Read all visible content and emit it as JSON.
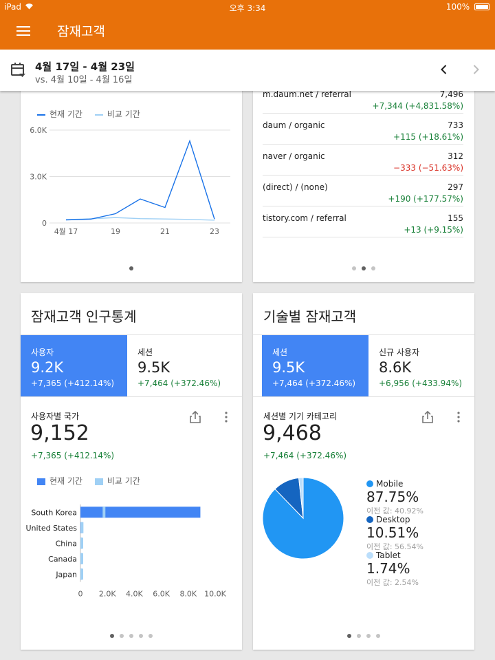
{
  "status": {
    "device": "iPad",
    "time": "오후 3:34",
    "battery": "100%"
  },
  "app": {
    "title": "잠재고객"
  },
  "date_range": {
    "main": "4월 17일 - 4월 23일",
    "comparison": "vs. 4월 10일 - 4월 16일"
  },
  "colors": {
    "brand": "#e8710a",
    "accent": "#4285f4",
    "positive": "#188038",
    "negative": "#d93025"
  },
  "icons": [
    "menu-icon",
    "calendar-icon",
    "chevron-left-icon",
    "chevron-right-icon",
    "share-icon",
    "more-vert-icon"
  ],
  "line_card": {
    "legend_current": "현재 기간",
    "legend_compare": "비교 기간",
    "page_dots": 1,
    "active_dot": 0
  },
  "referral_card": {
    "rows": [
      {
        "name": "m.daum.net / referral",
        "value": "7,496",
        "delta": "+7,344 (+4,831.58%)",
        "sign": "pos"
      },
      {
        "name": "daum / organic",
        "value": "733",
        "delta": "+115 (+18.61%)",
        "sign": "pos"
      },
      {
        "name": "naver / organic",
        "value": "312",
        "delta": "−333 (−51.63%)",
        "sign": "neg"
      },
      {
        "name": "(direct) / (none)",
        "value": "297",
        "delta": "+190 (+177.57%)",
        "sign": "pos"
      },
      {
        "name": "tistory.com / referral",
        "value": "155",
        "delta": "+13 (+9.15%)",
        "sign": "pos"
      }
    ],
    "page_dots": 3,
    "active_dot": 1
  },
  "demo_card": {
    "title": "잠재고객 인구통계",
    "tiles": [
      {
        "label": "사용자",
        "value": "9.2K",
        "delta": "+7,365 (+412.14%)"
      },
      {
        "label": "세션",
        "value": "9.5K",
        "delta": "+7,464 (+372.46%)"
      }
    ],
    "sub_label": "사용자별 국가",
    "big_number": "9,152",
    "big_delta": "+7,365 (+412.14%)",
    "legend_current": "현재 기간",
    "legend_compare": "비교 기간",
    "page_dots": 5,
    "active_dot": 0
  },
  "tech_card": {
    "title": "기술별 잠재고객",
    "tiles": [
      {
        "label": "세션",
        "value": "9.5K",
        "delta": "+7,464 (+372.46%)"
      },
      {
        "label": "신규 사용자",
        "value": "8.6K",
        "delta": "+6,956 (+433.94%)"
      }
    ],
    "sub_label": "세션별 기기 카테고리",
    "big_number": "9,468",
    "big_delta": "+7,464 (+372.46%)",
    "legend": [
      {
        "name": "Mobile",
        "pct": "87.75%",
        "prev": "이전 값: 40.92%",
        "color": "#2196f3"
      },
      {
        "name": "Desktop",
        "pct": "10.51%",
        "prev": "이전 값: 56.54%",
        "color": "#1565c0"
      },
      {
        "name": "Tablet",
        "pct": "1.74%",
        "prev": "이전 값: 2.54%",
        "color": "#bbdefb"
      }
    ],
    "page_dots": 4,
    "active_dot": 0
  },
  "chart_data": [
    {
      "type": "line",
      "x": [
        "4월 17",
        "18",
        "19",
        "20",
        "21",
        "22",
        "23"
      ],
      "x_tick_labels": [
        "4월 17",
        "19",
        "21",
        "23"
      ],
      "y_tick_labels": [
        "0",
        "3.0K",
        "6.0K"
      ],
      "ylim": [
        0,
        6000
      ],
      "series": [
        {
          "name": "현재 기간",
          "color": "#1a73e8",
          "values": [
            200,
            250,
            600,
            1550,
            1000,
            5300,
            250
          ]
        },
        {
          "name": "비교 기간",
          "color": "#9fd0f5",
          "values": [
            220,
            270,
            350,
            280,
            260,
            230,
            180
          ]
        }
      ],
      "grid": true,
      "legend": "top-left"
    },
    {
      "type": "bar",
      "orientation": "horizontal",
      "categories": [
        "South Korea",
        "United States",
        "China",
        "Canada",
        "Japan"
      ],
      "series": [
        {
          "name": "현재 기간",
          "color": "#4285f4",
          "values": [
            8900,
            150,
            100,
            90,
            80
          ]
        },
        {
          "name": "비교 기간",
          "color": "#9fd0f5",
          "values": [
            1750,
            120,
            60,
            50,
            60
          ]
        }
      ],
      "x_tick_labels": [
        "0",
        "2.0K",
        "4.0K",
        "6.0K",
        "8.0K",
        "10.0K"
      ],
      "xlim": [
        0,
        10000
      ],
      "legend": "top-left"
    },
    {
      "type": "pie",
      "categories": [
        "Mobile",
        "Desktop",
        "Tablet"
      ],
      "values": [
        87.75,
        10.51,
        1.74
      ],
      "colors": [
        "#2196f3",
        "#1565c0",
        "#bbdefb"
      ],
      "legend": "right"
    }
  ]
}
